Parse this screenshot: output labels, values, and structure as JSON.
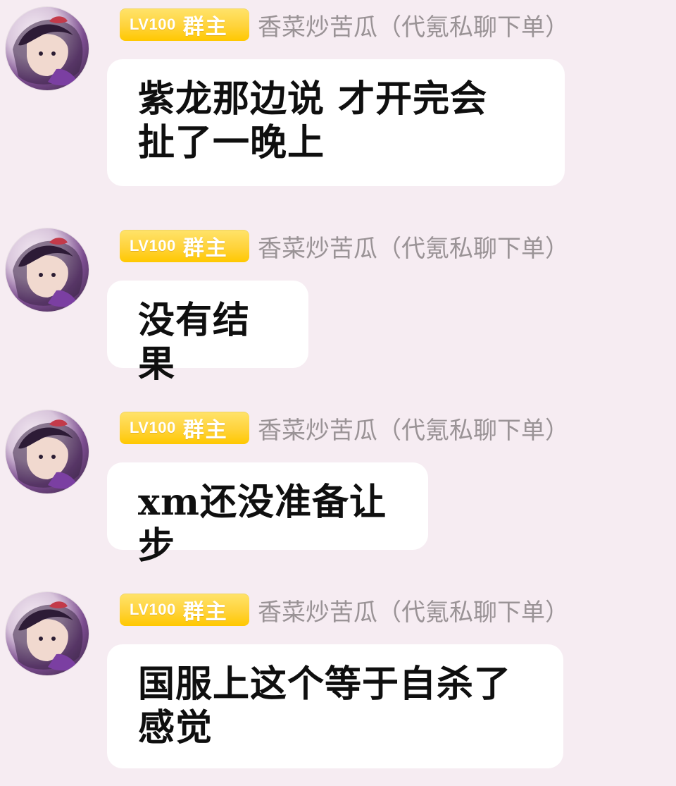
{
  "messages": [
    {
      "badge_level": "LV100",
      "badge_role": "群主",
      "sender": "香菜炒苦瓜（代氪私聊下单）",
      "text": "紫龙那边说 才开完会 扯了一晚上"
    },
    {
      "badge_level": "LV100",
      "badge_role": "群主",
      "sender": "香菜炒苦瓜（代氪私聊下单）",
      "text": "没有结果"
    },
    {
      "badge_level": "LV100",
      "badge_role": "群主",
      "sender": "香菜炒苦瓜（代氪私聊下单）",
      "text": "xm还没准备让步"
    },
    {
      "badge_level": "LV100",
      "badge_role": "群主",
      "sender": "香菜炒苦瓜（代氪私聊下单）",
      "text": "国服上这个等于自杀了感觉"
    }
  ],
  "avatar_icon": "anime-character-avatar-icon",
  "colors": {
    "background": "#f6ecf2",
    "badge": "#ffd33a",
    "bubble": "#ffffff",
    "nickname": "#9a9396"
  }
}
